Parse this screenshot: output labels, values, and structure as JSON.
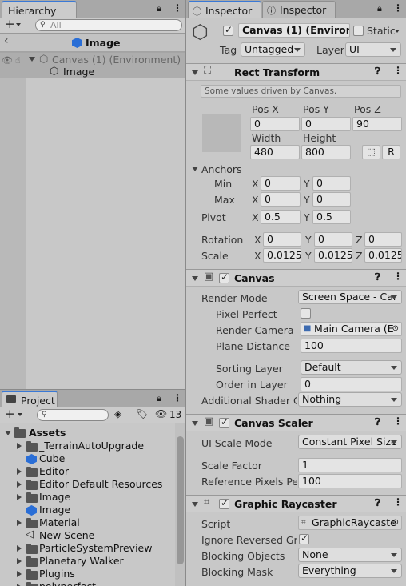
{
  "hierarchy": {
    "tab_label": "Hierarchy",
    "add_label": "+",
    "search_placeholder": "All",
    "breadcrumb": "Image",
    "items": [
      {
        "label": "Canvas (1) (Environment)"
      },
      {
        "label": "Image"
      }
    ]
  },
  "project": {
    "tab_label": "Project",
    "add_label": "+",
    "hidden_count": "13",
    "root": "Assets",
    "items": [
      {
        "label": "_TerrainAutoUpgrade",
        "kind": "folder"
      },
      {
        "label": "Cube",
        "kind": "prefab"
      },
      {
        "label": "Editor",
        "kind": "folder"
      },
      {
        "label": "Editor Default Resources",
        "kind": "folder"
      },
      {
        "label": "Image",
        "kind": "folder"
      },
      {
        "label": "Image",
        "kind": "prefab"
      },
      {
        "label": "Material",
        "kind": "folder"
      },
      {
        "label": "New Scene",
        "kind": "scene"
      },
      {
        "label": "ParticleSystemPreview",
        "kind": "folder"
      },
      {
        "label": "Planetary Walker",
        "kind": "folder"
      },
      {
        "label": "Plugins",
        "kind": "folder"
      },
      {
        "label": "polyperfect",
        "kind": "folder"
      }
    ]
  },
  "inspector": {
    "tab1_label": "Inspector",
    "tab2_label": "Inspector",
    "object_name": "Canvas (1) (Environme",
    "static_label": "Static",
    "tag_label": "Tag",
    "tag_value": "Untagged",
    "layer_label": "Layer",
    "layer_value": "UI",
    "rect_transform": {
      "title": "Rect Transform",
      "note": "Some values driven by Canvas.",
      "posx_label": "Pos X",
      "posy_label": "Pos Y",
      "posz_label": "Pos Z",
      "posx": "0",
      "posy": "0",
      "posz": "90",
      "width_label": "Width",
      "height_label": "Height",
      "width": "480",
      "height": "800",
      "r_label": "R",
      "anchors_label": "Anchors",
      "min_label": "Min",
      "max_label": "Max",
      "min_x": "0",
      "min_y": "0",
      "max_x": "0",
      "max_y": "0",
      "pivot_label": "Pivot",
      "pivot_x": "0.5",
      "pivot_y": "0.5",
      "rotation_label": "Rotation",
      "rot_x": "0",
      "rot_y": "0",
      "rot_z": "0",
      "scale_label": "Scale",
      "scale_x": "0.0125",
      "scale_y": "0.0125",
      "scale_z": "0.0125",
      "x": "X",
      "y": "Y",
      "z": "Z"
    },
    "canvas": {
      "title": "Canvas",
      "render_mode_label": "Render Mode",
      "render_mode": "Screen Space - Car",
      "pixel_perfect_label": "Pixel Perfect",
      "render_camera_label": "Render Camera",
      "render_camera": "Main Camera (E",
      "plane_distance_label": "Plane Distance",
      "plane_distance": "100",
      "sorting_layer_label": "Sorting Layer",
      "sorting_layer": "Default",
      "order_in_layer_label": "Order in Layer",
      "order_in_layer": "0",
      "shader_ch_label": "Additional Shader Ch",
      "shader_ch": "Nothing"
    },
    "canvas_scaler": {
      "title": "Canvas Scaler",
      "ui_scale_mode_label": "UI Scale Mode",
      "ui_scale_mode": "Constant Pixel Size",
      "scale_factor_label": "Scale Factor",
      "scale_factor": "1",
      "ref_ppu_label": "Reference Pixels Per",
      "ref_ppu": "100"
    },
    "graphic_raycaster": {
      "title": "Graphic Raycaster",
      "script_label": "Script",
      "script": "GraphicRaycaste",
      "ignore_reversed_label": "Ignore Reversed Grap",
      "blocking_objects_label": "Blocking Objects",
      "blocking_objects": "None",
      "blocking_mask_label": "Blocking Mask",
      "blocking_mask": "Everything"
    }
  }
}
